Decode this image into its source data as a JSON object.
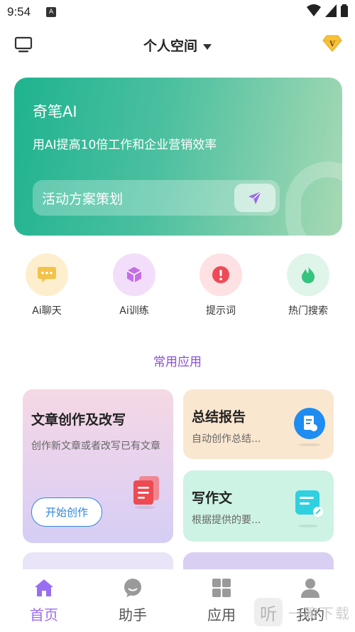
{
  "status_bar": {
    "time": "9:54",
    "notif_glyph": "A"
  },
  "header": {
    "title": "个人空间"
  },
  "hero": {
    "title": "奇笔AI",
    "subtitle": "用AI提高10倍工作和企业营销效率",
    "search_placeholder": "活动方案策划"
  },
  "quick_actions": [
    {
      "label": "Ai聊天",
      "icon": "chat-icon",
      "bg": "#fdeecd",
      "color": "#f3c24a"
    },
    {
      "label": "Ai训练",
      "icon": "cube-icon",
      "bg": "#f2defa",
      "color": "#c66ee6"
    },
    {
      "label": "提示词",
      "icon": "alert-icon",
      "bg": "#fde1e3",
      "color": "#ef4b57"
    },
    {
      "label": "热门搜索",
      "icon": "flame-icon",
      "bg": "#dff5ea",
      "color": "#35c47c"
    }
  ],
  "section": {
    "title": "常用应用"
  },
  "apps": {
    "article": {
      "title": "文章创作及改写",
      "desc": "创作新文章或者改写已有文章",
      "button": "开始创作",
      "icon": "document-stack-icon"
    },
    "summary": {
      "title": "总结报告",
      "desc": "自动创作总结...",
      "icon": "report-icon"
    },
    "essay": {
      "title": "写作文",
      "desc": "根据提供的要...",
      "icon": "note-edit-icon"
    }
  },
  "bottom_nav": [
    {
      "label": "首页",
      "icon": "home-icon",
      "active": true
    },
    {
      "label": "助手",
      "icon": "chat-bubble-icon",
      "active": false
    },
    {
      "label": "应用",
      "icon": "grid-icon",
      "active": false
    },
    {
      "label": "我的",
      "icon": "person-icon",
      "active": false
    }
  ],
  "watermark": {
    "glyph": "听",
    "text": "一聊下载"
  },
  "colors": {
    "accent": "#8a4fd9",
    "hero_start": "#1fb38e",
    "link_blue": "#2f86e0"
  }
}
